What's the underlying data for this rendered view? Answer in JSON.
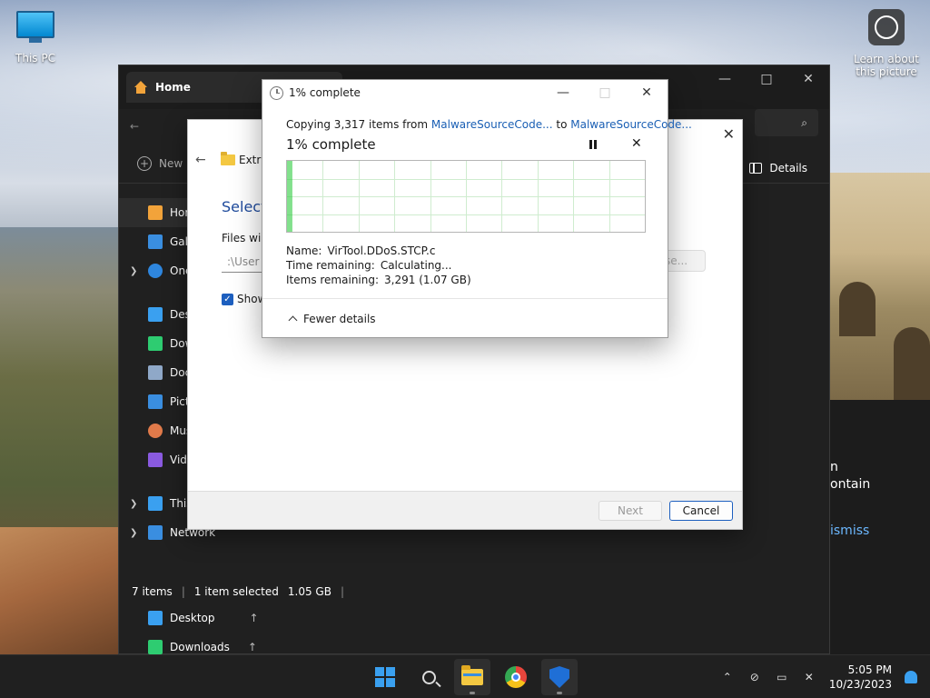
{
  "desktop": {
    "this_pc_label": "This PC",
    "learn_label_line1": "Learn about",
    "learn_label_line2": "this picture"
  },
  "explorer": {
    "tab_title": "Home",
    "new_label": "New",
    "details_label": "Details",
    "nav_items": [
      {
        "label": "Home",
        "icon": "home-icon",
        "color": "#f2a33a"
      },
      {
        "label": "Gallery",
        "icon": "gallery-icon",
        "color": "#3a8ee0"
      },
      {
        "label": "OneDrive",
        "icon": "cloud-icon",
        "color": "#2e86de"
      },
      {
        "label": "Desktop",
        "icon": "desktop-icon",
        "color": "#3aa0f0"
      },
      {
        "label": "Downloads",
        "icon": "download-icon",
        "color": "#2ecc71"
      },
      {
        "label": "Documents",
        "icon": "document-icon",
        "color": "#8fa8c8"
      },
      {
        "label": "Pictures",
        "icon": "pictures-icon",
        "color": "#3a8ee0"
      },
      {
        "label": "Music",
        "icon": "music-icon",
        "color": "#e07a4a"
      },
      {
        "label": "Videos",
        "icon": "video-icon",
        "color": "#8a5ae0"
      }
    ],
    "this_pc": "This PC",
    "network": "Network",
    "status": {
      "items": "7 items",
      "selected": "1 item selected",
      "size": "1.05 GB"
    },
    "lower_items": [
      {
        "label": "Desktop",
        "icon": "desktop-icon",
        "color": "#3aa0f0"
      },
      {
        "label": "Downloads",
        "icon": "download-icon",
        "color": "#2ecc71"
      }
    ],
    "right_text_1": "n",
    "right_text_2": "ontain",
    "right_text_3": "ismiss"
  },
  "wizard": {
    "title": "Extra",
    "heading": "Select",
    "files_will": "Files will",
    "path_value": ":\\User",
    "browse_label": "se...",
    "show_label": "Show",
    "next_label": "Next",
    "cancel_label": "Cancel"
  },
  "progress": {
    "title": "1% complete",
    "copying_prefix": "Copying 3,317 items from ",
    "source": "MalwareSourceCode...",
    "to": " to ",
    "dest": "MalwareSourceCode...",
    "percent_text": "1% complete",
    "percent_value": 1,
    "name_label": "Name:",
    "name_value": "VirTool.DDoS.STCP.c",
    "time_label": "Time remaining:",
    "time_value": "Calculating...",
    "items_label": "Items remaining:",
    "items_value": "3,291 (1.07 GB)",
    "fewer_details": "Fewer details",
    "graph_color": "#2ecc40"
  },
  "taskbar": {
    "time": "5:05 PM",
    "date": "10/23/2023"
  }
}
